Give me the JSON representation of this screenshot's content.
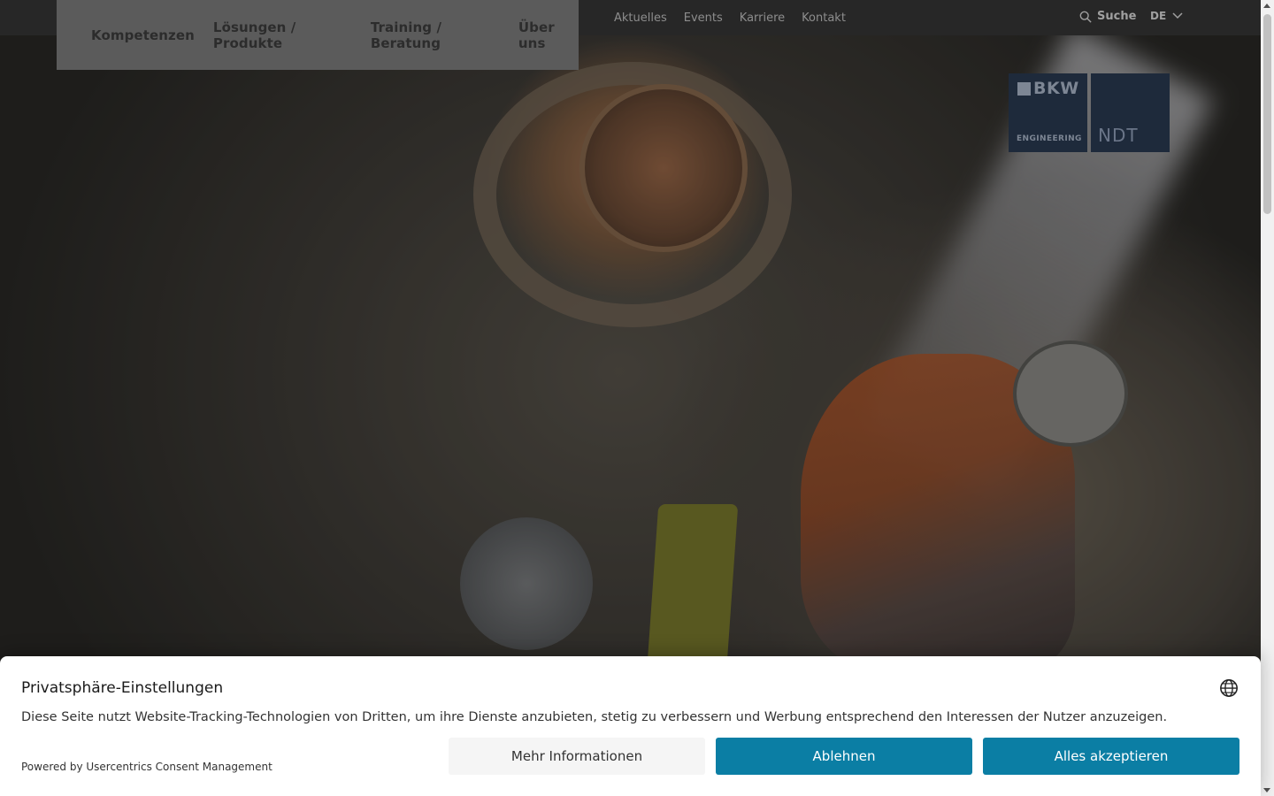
{
  "top_nav": {
    "links": [
      "Aktuelles",
      "Events",
      "Karriere",
      "Kontakt"
    ],
    "search_label": "Suche",
    "language": "DE"
  },
  "main_nav": {
    "items": [
      "Kompetenzen",
      "Lösungen / Produkte",
      "Training / Beratung",
      "Über uns"
    ]
  },
  "logo": {
    "brand": "BKW",
    "sub": "ENGINEERING",
    "unit": "NDT"
  },
  "consent": {
    "title": "Privatsphäre-Einstellungen",
    "text": "Diese Seite nutzt Website-Tracking-Technologien von Dritten, um ihre Dienste anzubieten, stetig zu verbessern und Werbung entsprechend den Interessen der Nutzer anzuzeigen.",
    "powered_by": "Powered by Usercentrics Consent Management",
    "buttons": {
      "more": "Mehr Informationen",
      "decline": "Ablehnen",
      "accept": "Alles akzeptieren"
    }
  },
  "colors": {
    "accent": "#0b7ea4",
    "logo_bg": "#1e2a3b"
  }
}
